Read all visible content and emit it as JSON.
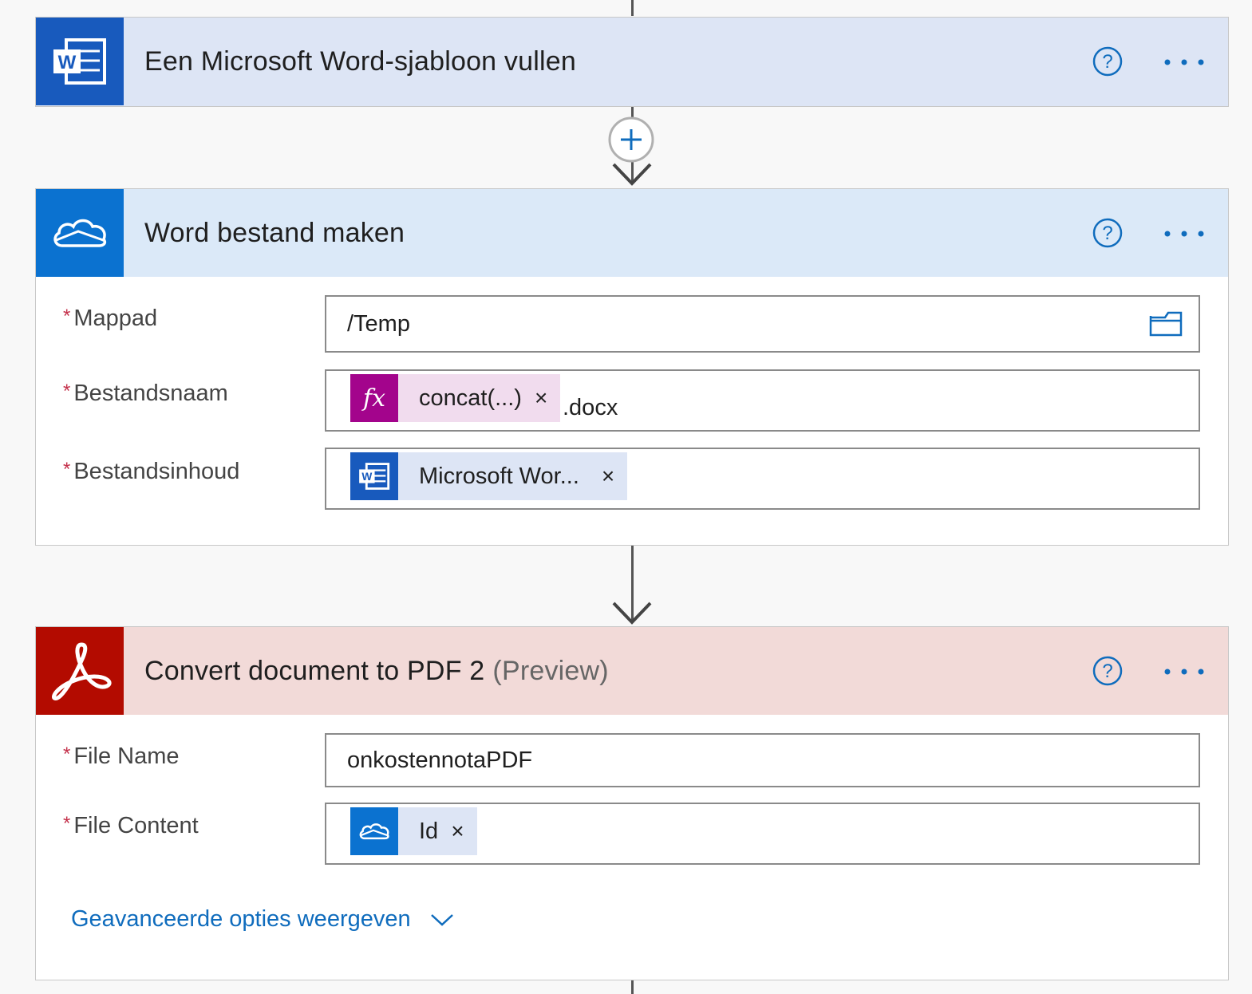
{
  "colors": {
    "word_blue": "#185abd",
    "onedrive_blue": "#0b72d0",
    "adobe_red": "#b30b00",
    "expression_purple": "#a3048c",
    "link_blue": "#0f6cbd"
  },
  "step1": {
    "title": "Een Microsoft Word-sjabloon vullen",
    "icon": "word-icon"
  },
  "step2": {
    "title": "Word bestand maken",
    "icon": "onedrive-icon",
    "fields": [
      {
        "label": "Mappad",
        "value": "/Temp",
        "icon": "folder-icon"
      },
      {
        "label": "Bestandsnaam",
        "token": "concat(...)",
        "token_icon": "fx-icon",
        "suffix": ".docx"
      },
      {
        "label": "Bestandsinhoud",
        "token": "Microsoft Wor...",
        "token_icon": "word-icon"
      }
    ]
  },
  "step3": {
    "title": "Convert document to PDF 2",
    "title_suffix": "(Preview)",
    "icon": "adobe-acrobat-icon",
    "fields": [
      {
        "label": "File Name",
        "value": "onkostennotaPDF"
      },
      {
        "label": "File Content",
        "token": "Id",
        "token_icon": "onedrive-icon"
      }
    ],
    "advanced_label": "Geavanceerde opties weergeven"
  },
  "required_marker": "*",
  "token_remove": "×"
}
